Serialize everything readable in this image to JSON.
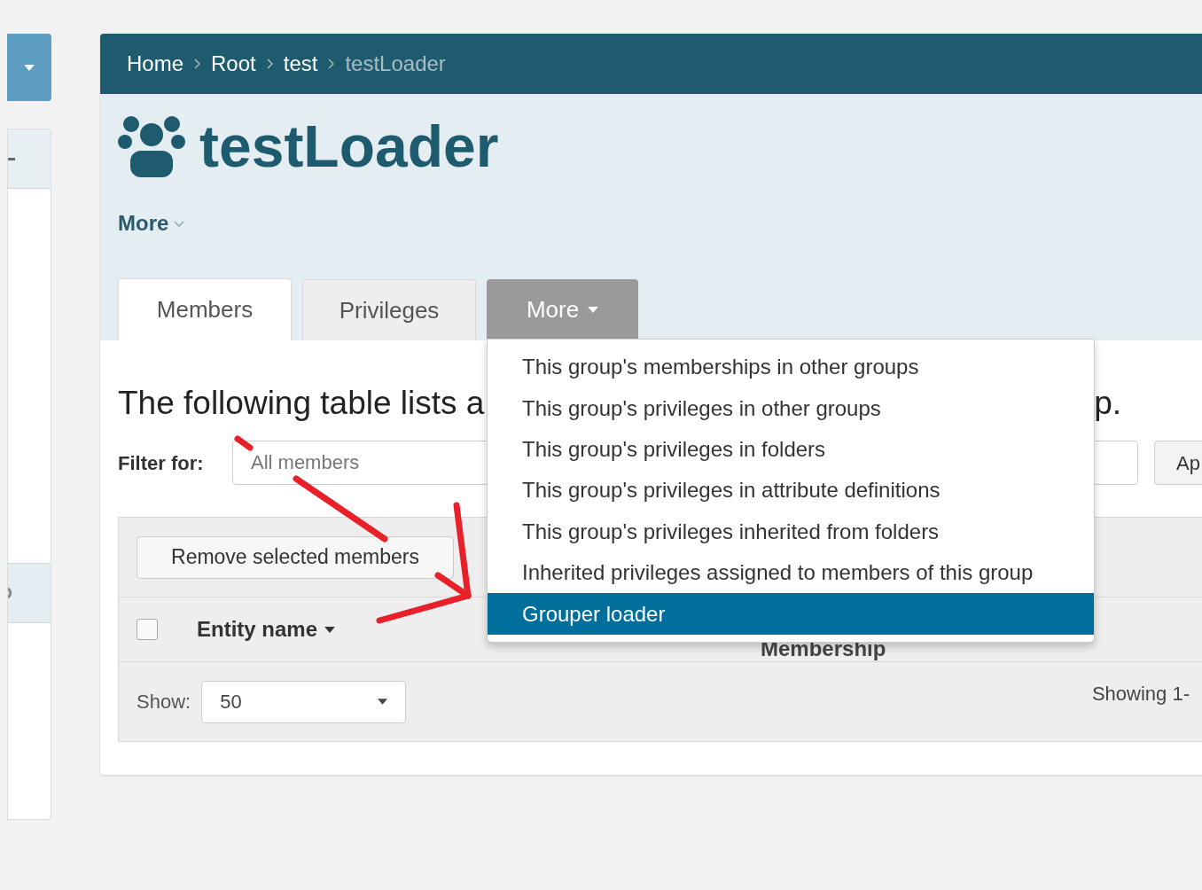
{
  "breadcrumb": [
    {
      "label": "Home",
      "current": false
    },
    {
      "label": "Root",
      "current": false
    },
    {
      "label": "test",
      "current": false
    },
    {
      "label": "testLoader",
      "current": true
    }
  ],
  "title": "testLoader",
  "more_link": "More",
  "tabs": [
    {
      "label": "Members",
      "selected": true,
      "kind": "tab"
    },
    {
      "label": "Privileges",
      "selected": false,
      "kind": "tab"
    },
    {
      "label": "More",
      "selected": false,
      "kind": "dropdown",
      "expanded": true
    }
  ],
  "dropdown_menu": [
    {
      "label": "This group's memberships in other groups",
      "selected": false
    },
    {
      "label": "This group's privileges in other groups",
      "selected": false
    },
    {
      "label": "This group's privileges in folders",
      "selected": false
    },
    {
      "label": "This group's privileges in attribute definitions",
      "selected": false
    },
    {
      "label": "This group's privileges inherited from folders",
      "selected": false
    },
    {
      "label": "Inherited privileges assigned to members of this group",
      "selected": false
    },
    {
      "label": "Grouper loader",
      "selected": true
    }
  ],
  "heading": {
    "start": "The following table lists a",
    "end": "p."
  },
  "filter": {
    "label": "Filter for:",
    "placeholder": "All members",
    "apply_button": "Ap"
  },
  "table": {
    "remove_button": "Remove selected members",
    "select_all_checked": false,
    "columns": [
      {
        "label": "Entity name",
        "sorted": true
      },
      {
        "label": "Membership",
        "sorted": false
      }
    ]
  },
  "footer": {
    "show_label": "Show:",
    "page_size": "50",
    "summary": "Showing 1-"
  }
}
